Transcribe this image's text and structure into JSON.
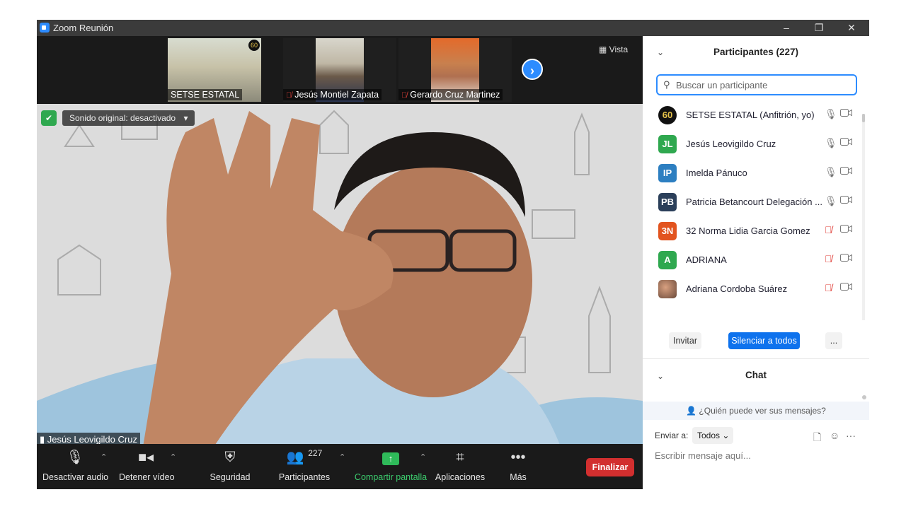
{
  "window": {
    "title": "Zoom Reunión"
  },
  "thumbnails": [
    {
      "name": "SETSE ESTATAL",
      "muted": false
    },
    {
      "name": "Jesús Montiel Zapata",
      "muted": true
    },
    {
      "name": "Gerardo Cruz Martinez",
      "muted": true
    }
  ],
  "view_label": "Vista",
  "sound_original": "Sonido original: desactivado",
  "active_speaker": "Jesús Leovigildo Cruz",
  "toolbar": {
    "audio": "Desactivar audio",
    "video": "Detener vídeo",
    "security": "Seguridad",
    "participants": "Participantes",
    "participants_count": "227",
    "share": "Compartir pantalla",
    "apps": "Aplicaciones",
    "more": "Más",
    "end": "Finalizar"
  },
  "participants_panel": {
    "title": "Participantes (227)",
    "search_placeholder": "Buscar un participante",
    "items": [
      {
        "initials": "60",
        "name": "SETSE ESTATAL (Anfitrión, yo)",
        "color": "#111111",
        "muted": false
      },
      {
        "initials": "JL",
        "name": "Jesús Leovigildo Cruz",
        "color": "#2fa84f",
        "muted": false
      },
      {
        "initials": "IP",
        "name": "Imelda Pánuco",
        "color": "#2d7fc1",
        "muted": false
      },
      {
        "initials": "PB",
        "name": "Patricia Betancourt Delegación ...",
        "color": "#2b3f5a",
        "muted": false
      },
      {
        "initials": "3N",
        "name": "32 Norma Lidia Garcia Gomez",
        "color": "#e2541f",
        "muted": true
      },
      {
        "initials": "A",
        "name": "ADRIANA",
        "color": "#2fa84f",
        "muted": true
      },
      {
        "initials": "",
        "name": "Adriana Cordoba Suárez",
        "color": "#8a5a3a",
        "muted": true
      }
    ],
    "invite": "Invitar",
    "mute_all": "Silenciar a todos",
    "more": "..."
  },
  "chat": {
    "title": "Chat",
    "who_can_see": "¿Quién puede ver sus mensajes?",
    "send_to_label": "Enviar a:",
    "send_to_value": "Todos",
    "placeholder": "Escribir mensaje aquí..."
  }
}
